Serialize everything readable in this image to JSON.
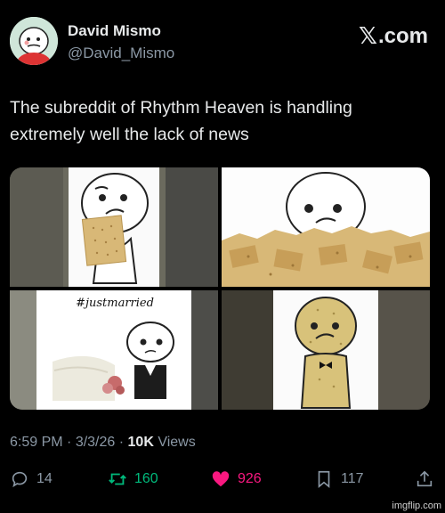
{
  "author": {
    "name": "David Mismo",
    "handle": "@David_Mismo"
  },
  "brand": {
    "x_letter": "𝕏",
    "suffix": ".com"
  },
  "tweet": {
    "text": "The subreddit of Rhythm Heaven is handling extremely well the lack of news"
  },
  "media": {
    "panel3_caption": "#justmarried"
  },
  "meta": {
    "time": "6:59 PM",
    "separator1": " · ",
    "date": "3/3/26",
    "separator2": " · ",
    "views_count": "10K",
    "views_label": " Views"
  },
  "actions": {
    "replies": "14",
    "retweets": "160",
    "likes": "926",
    "bookmarks": "117"
  },
  "colors": {
    "background": "#000000",
    "retweet": "#00ba7c",
    "like": "#f91880",
    "muted": "#8b98a5"
  },
  "icons": [
    "reply-icon",
    "retweet-icon",
    "heart-icon",
    "bookmark-icon",
    "share-icon"
  ],
  "watermark": "imgflip.com"
}
